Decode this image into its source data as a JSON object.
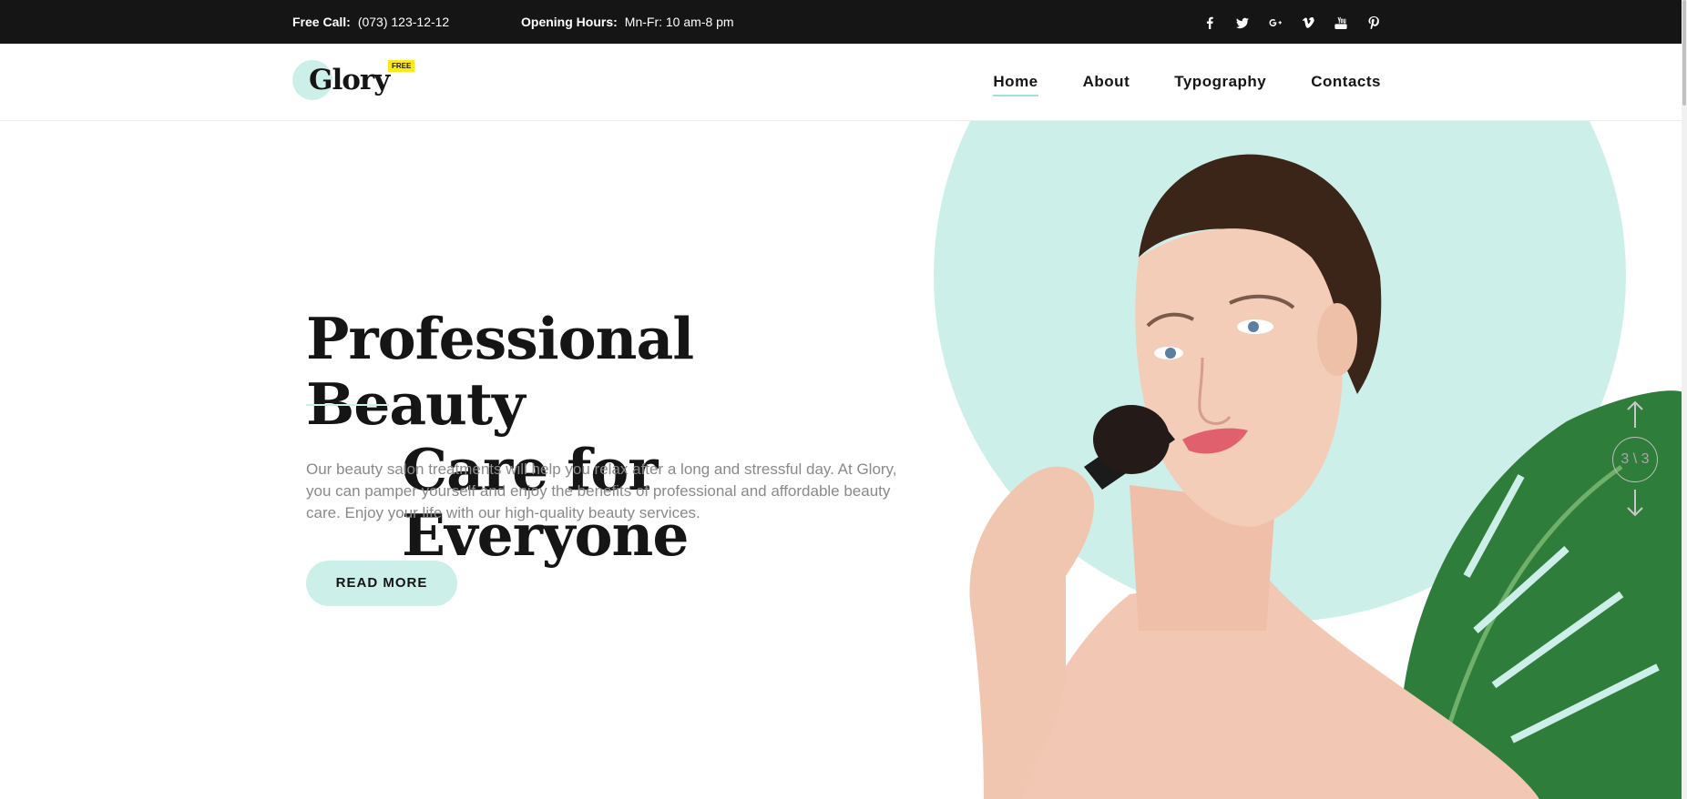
{
  "topbar": {
    "call_label": "Free Call:",
    "call_value": "(073) 123-12-12",
    "hours_label": "Opening Hours:",
    "hours_value": "Mn-Fr: 10 am-8 pm",
    "social": [
      {
        "name": "facebook-icon",
        "glyph": "f"
      },
      {
        "name": "twitter-icon",
        "glyph": "t"
      },
      {
        "name": "google-plus-icon",
        "glyph": "G+"
      },
      {
        "name": "vimeo-icon",
        "glyph": "v"
      },
      {
        "name": "youtube-icon",
        "glyph": "yt"
      },
      {
        "name": "pinterest-icon",
        "glyph": "p"
      }
    ]
  },
  "header": {
    "logo_text": "Glory",
    "logo_badge": "FREE",
    "nav": [
      {
        "label": "Home",
        "active": true
      },
      {
        "label": "About",
        "active": false
      },
      {
        "label": "Typography",
        "active": false
      },
      {
        "label": "Contacts",
        "active": false
      }
    ]
  },
  "hero": {
    "title_line1": "Professional Beauty",
    "title_line2": "Care for Everyone",
    "text": "Our beauty salon treatments will help you relax after a long and stressful day. At Glory, you can pamper yourself and enjoy the benefits of professional and affordable beauty care. Enjoy your life with our high-quality beauty services.",
    "button_label": "READ MORE"
  },
  "slider": {
    "counter": "3 \\ 3"
  },
  "colors": {
    "topbar_bg": "#151515",
    "accent": "#cdefe9",
    "badge": "#ffe81a",
    "text_muted": "#8a8a8a"
  }
}
